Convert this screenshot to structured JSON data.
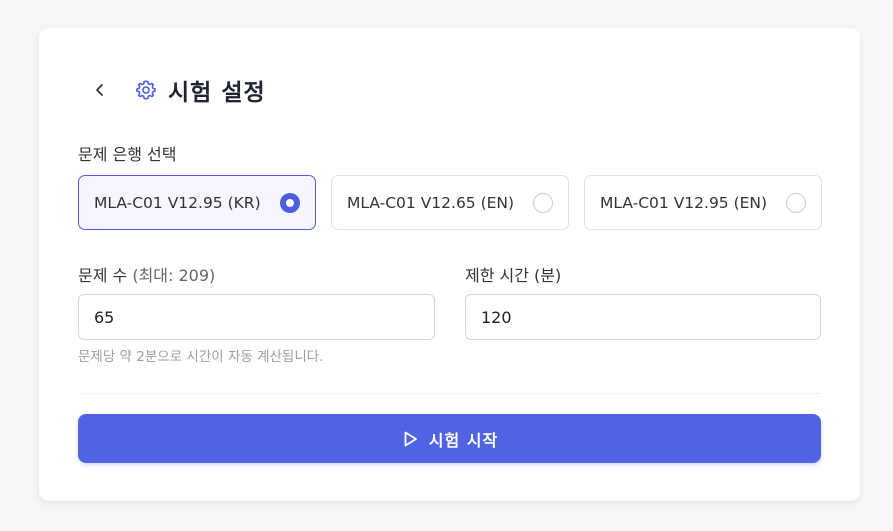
{
  "header": {
    "title": "시험 설정",
    "back_icon": "chevron-left-icon",
    "title_icon": "gear-icon"
  },
  "bank_section": {
    "label": "문제 은행 선택",
    "options": [
      {
        "label": "MLA-C01 V12.95 (KR)",
        "selected": true
      },
      {
        "label": "MLA-C01 V12.65 (EN)",
        "selected": false
      },
      {
        "label": "MLA-C01 V12.95 (EN)",
        "selected": false
      }
    ]
  },
  "question_count": {
    "label": "문제 수",
    "max_note": "(최대: 209)",
    "value": "65"
  },
  "time_limit": {
    "label": "제한 시간 (분)",
    "value": "120"
  },
  "hint": "문제당 약 2분으로 시간이 자동 계산됩니다.",
  "start_button": {
    "label": "시험 시작",
    "icon": "play-icon"
  },
  "colors": {
    "accent": "#4f63e3",
    "selected_bg": "#f5f6fe",
    "background": "#f6f7f9"
  }
}
